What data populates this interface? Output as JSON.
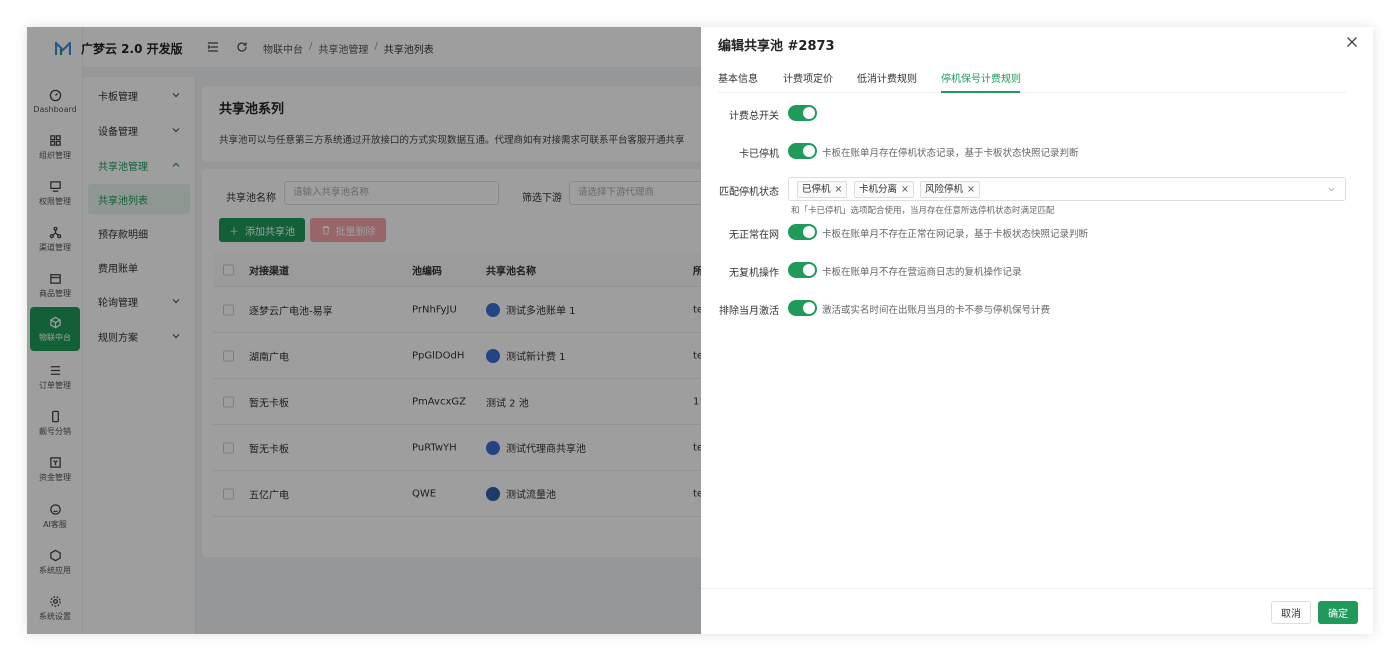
{
  "app": {
    "name": "广梦云 2.0 开发版",
    "brand_color": "#1f9a5b"
  },
  "rail": [
    {
      "label": "Dashboard",
      "icon": "dashboard-icon"
    },
    {
      "label": "组织管理",
      "icon": "grid-icon"
    },
    {
      "label": "权限管理",
      "icon": "monitor-icon"
    },
    {
      "label": "渠道管理",
      "icon": "network-icon"
    },
    {
      "label": "商品管理",
      "icon": "shop-icon"
    },
    {
      "label": "物联中台",
      "icon": "cube-icon",
      "active": true
    },
    {
      "label": "订单管理",
      "icon": "list-icon"
    },
    {
      "label": "靓号分销",
      "icon": "phone-icon"
    },
    {
      "label": "资金管理",
      "icon": "wallet-icon"
    },
    {
      "label": "AI客服",
      "icon": "bot-icon"
    },
    {
      "label": "系统应用",
      "icon": "apps-icon"
    },
    {
      "label": "系统设置",
      "icon": "gear-icon"
    }
  ],
  "menu": [
    {
      "label": "卡板管理"
    },
    {
      "label": "设备管理"
    },
    {
      "label": "共享池管理"
    },
    {
      "label": "共享池列表"
    },
    {
      "label": "预存款明细"
    },
    {
      "label": "费用账单"
    },
    {
      "label": "轮询管理"
    },
    {
      "label": "规则方案"
    }
  ],
  "breadcrumb": [
    "物联中台",
    "共享池管理",
    "共享池列表"
  ],
  "breadcrumb_sep": "/",
  "page": {
    "title": "共享池系列",
    "description": "共享池可以与任意第三方系统通过开放接口的方式实现数据互通。代理商如有对接需求可联系平台客服开通共享"
  },
  "filters": {
    "name_label": "共享池名称",
    "name_placeholder": "请输入共享池名称",
    "downstream_label": "筛选下游",
    "downstream_placeholder": "请选择下游代理商"
  },
  "actions": {
    "add": "添加共享池",
    "batch_delete": "批量删除"
  },
  "table": {
    "columns": [
      "对接渠道",
      "池编码",
      "共享池名称",
      "所"
    ],
    "rows": [
      {
        "channel": "逐梦云广电池-易享",
        "code": "PrNhFyJU",
        "name": "测试多池账单 1",
        "extra": "te",
        "icon": true
      },
      {
        "channel": "湖南广电",
        "code": "PpGlDOdH",
        "name": "测试新计费 1",
        "extra": "te",
        "icon": true
      },
      {
        "channel": "暂无卡板",
        "code": "PmAvcxGZ",
        "name": "测试 2 池",
        "extra": "1!",
        "icon": false
      },
      {
        "channel": "暂无卡板",
        "code": "PuRTwYH",
        "name": "测试代理商共享池",
        "extra": "te",
        "icon": true
      },
      {
        "channel": "五亿广电",
        "code": "QWE",
        "name": "测试流量池",
        "extra": "te",
        "icon": true
      }
    ]
  },
  "drawer": {
    "title": "编辑共享池 #2873",
    "tabs": [
      "基本信息",
      "计费项定价",
      "低消计费规则",
      "停机保号计费规则"
    ],
    "active_tab": 3,
    "fields": {
      "master_switch": {
        "label": "计费总开关",
        "on": true
      },
      "card_stopped": {
        "label": "卡已停机",
        "on": true,
        "hint": "卡板在账单月存在停机状态记录，基于卡板状态快照记录判断"
      },
      "match_status": {
        "label": "匹配停机状态",
        "tags": [
          "已停机",
          "卡机分离",
          "风险停机"
        ],
        "note": "和「卡已停机」选项配合使用，当月存在任意所选停机状态时满足匹配"
      },
      "no_online": {
        "label": "无正常在网",
        "on": true,
        "hint": "卡板在账单月不存在正常在网记录，基于卡板状态快照记录判断"
      },
      "no_resume": {
        "label": "无复机操作",
        "on": true,
        "hint": "卡板在账单月不存在营运商日志的复机操作记录"
      },
      "exclude_month": {
        "label": "排除当月激活",
        "on": true,
        "hint": "激活或实名时间在出账月当月的卡不参与停机保号计费"
      }
    },
    "tag_close": "×",
    "cancel": "取消",
    "confirm": "确定"
  }
}
